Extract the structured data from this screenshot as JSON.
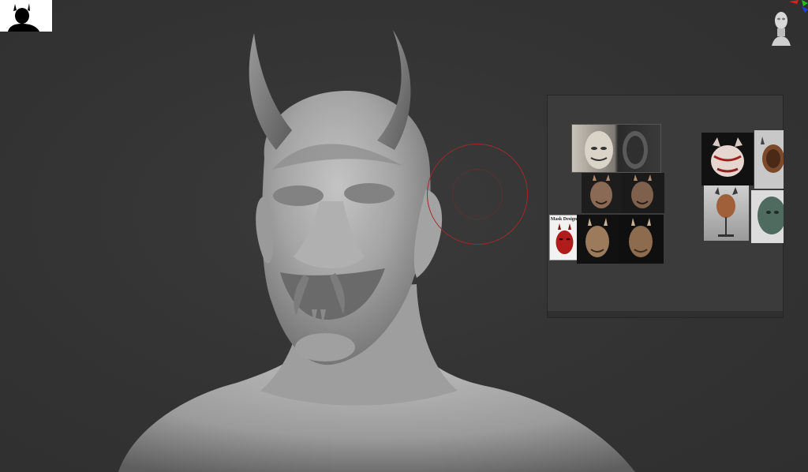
{
  "app": {
    "viewport_background": "#353535",
    "model_color": "#a9a9a9"
  },
  "thumbnail": {
    "icon": "demon-silhouette-icon"
  },
  "gizmo": {
    "icon": "head-orientation-gizmo-icon",
    "axis_colors": [
      "#e02020",
      "#20c020",
      "#2040e0"
    ]
  },
  "brush": {
    "cursor_color": "#a02a2a"
  },
  "spotlight": {
    "references": [
      {
        "name": "ref-white-oni-mask-front-back"
      },
      {
        "name": "ref-carved-oni-mask-front"
      },
      {
        "name": "ref-carved-oni-mask-side"
      },
      {
        "name": "ref-mask-design-sheet",
        "label": "Mask Design"
      },
      {
        "name": "ref-oni-mask-bronze-front"
      },
      {
        "name": "ref-oni-mask-bronze-side"
      },
      {
        "name": "ref-red-painted-oni-mask"
      },
      {
        "name": "ref-dark-oni-mask"
      },
      {
        "name": "ref-oni-mask-on-stand"
      },
      {
        "name": "ref-green-mask"
      }
    ]
  }
}
